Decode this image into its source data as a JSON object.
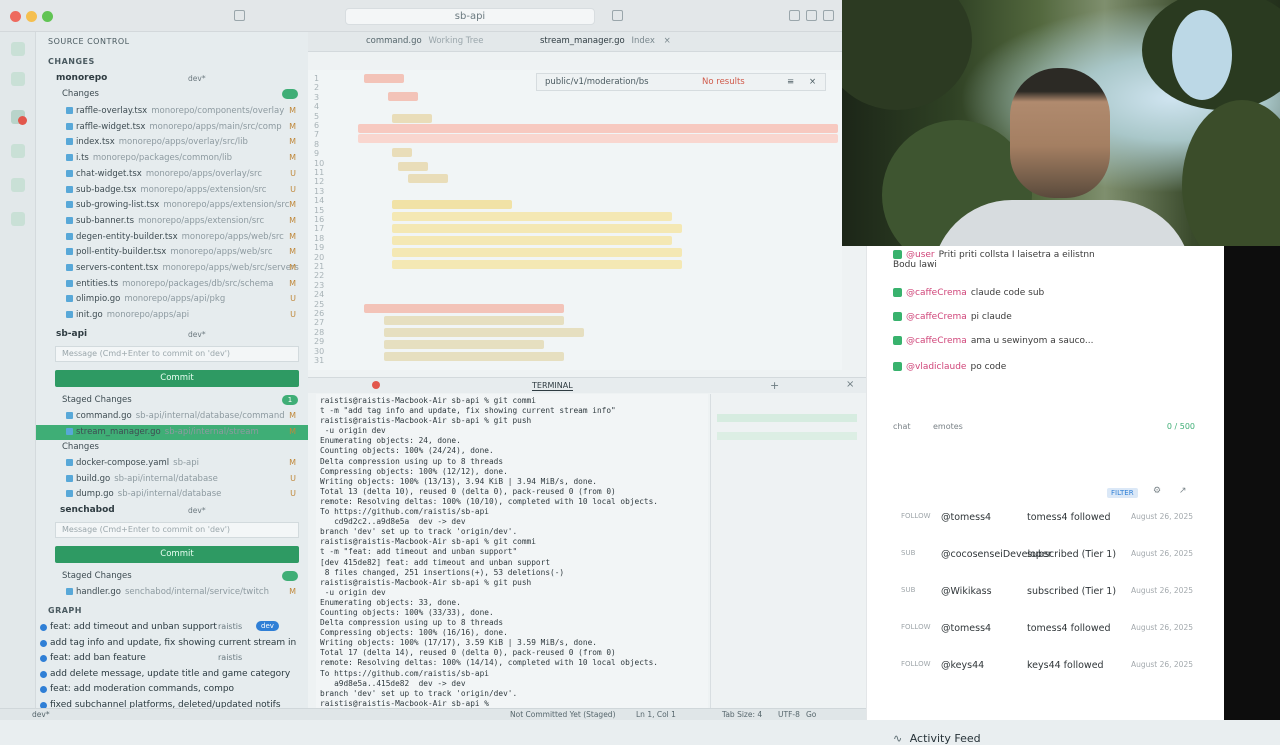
{
  "window": {
    "title": "sb-api",
    "search_placeholder": "sb-api"
  },
  "scm": {
    "header": "SOURCE CONTROL",
    "changes_heading": "CHANGES",
    "graph_heading": "GRAPH",
    "repos": [
      {
        "name": "monorepo",
        "branch": "dev*"
      },
      {
        "name": "sb-api",
        "branch": "dev*"
      },
      {
        "name": "senchabod",
        "branch": "dev*"
      }
    ],
    "monorepo_changes_label": "Changes",
    "monorepo_files": [
      {
        "name": "raffle-overlay.tsx",
        "path": "monorepo/components/overlay",
        "stat": "M"
      },
      {
        "name": "raffle-widget.tsx",
        "path": "monorepo/apps/main/src/comp",
        "stat": "M"
      },
      {
        "name": "index.tsx",
        "path": "monorepo/apps/overlay/src/lib",
        "stat": "M"
      },
      {
        "name": "i.ts",
        "path": "monorepo/packages/common/lib",
        "stat": "M"
      },
      {
        "name": "chat-widget.tsx",
        "path": "monorepo/apps/overlay/src",
        "stat": "U"
      },
      {
        "name": "sub-badge.tsx",
        "path": "monorepo/apps/extension/src",
        "stat": "U"
      },
      {
        "name": "sub-growing-list.tsx",
        "path": "monorepo/apps/extension/src",
        "stat": "M"
      },
      {
        "name": "sub-banner.ts",
        "path": "monorepo/apps/extension/src",
        "stat": "M"
      },
      {
        "name": "degen-entity-builder.tsx",
        "path": "monorepo/apps/web/src",
        "stat": "M"
      },
      {
        "name": "poll-entity-builder.tsx",
        "path": "monorepo/apps/web/src",
        "stat": "M"
      },
      {
        "name": "servers-content.tsx",
        "path": "monorepo/apps/web/src/servers",
        "stat": "M"
      },
      {
        "name": "entities.ts",
        "path": "monorepo/packages/db/src/schema",
        "stat": "M"
      },
      {
        "name": "olimpio.go",
        "path": "monorepo/apps/api/pkg",
        "stat": "U"
      },
      {
        "name": "init.go",
        "path": "monorepo/apps/api",
        "stat": "U"
      }
    ],
    "sbapi_input_placeholder": "Message (Cmd+Enter to commit on 'dev')",
    "commit_button": "Commit",
    "staged_label": "Staged Changes",
    "staged_count": "1",
    "sbapi_staged_files": [
      {
        "name": "command.go",
        "path": "sb-api/internal/database/command",
        "stat": "M"
      },
      {
        "name": "stream_manager.go",
        "path": "sb-api/internal/stream",
        "stat": "M"
      }
    ],
    "sbapi_changes_label": "Changes",
    "sbapi_files": [
      {
        "name": "docker-compose.yaml",
        "path": "sb-api",
        "stat": "M"
      },
      {
        "name": "build.go",
        "path": "sb-api/internal/database",
        "stat": "U"
      },
      {
        "name": "dump.go",
        "path": "sb-api/internal/database",
        "stat": "U"
      }
    ],
    "senchabod_input_placeholder": "Message (Cmd+Enter to commit on 'dev')",
    "senchabod_commit_button": "Commit",
    "senchabod_staged_label": "Staged Changes",
    "senchabod_staged_files": [
      {
        "name": "handler.go",
        "path": "senchabod/internal/service/twitch",
        "stat": "M"
      }
    ],
    "graph_commits": [
      {
        "text": "feat: add timeout and unban support",
        "author": "raistis",
        "tag": "dev"
      },
      {
        "text": "add tag info and update, fix showing current stream in",
        "author": "",
        "tag": ""
      },
      {
        "text": "feat: add ban feature",
        "author": "raistis",
        "tag": ""
      },
      {
        "text": "add delete message, update title and game category",
        "author": "",
        "tag": ""
      },
      {
        "text": "feat: add moderation commands, compo",
        "author": "",
        "tag": ""
      },
      {
        "text": "fixed subchannel platforms, deleted/updated notifs",
        "author": "",
        "tag": ""
      }
    ]
  },
  "editor": {
    "tabs": [
      {
        "label": "command.go",
        "note": "Working Tree",
        "active": false
      },
      {
        "label": "stream_manager.go",
        "note": "Index",
        "active": true
      }
    ],
    "find_query": "public/v1/moderation/bs",
    "find_result": "No results",
    "line_numbers": [
      "1",
      "2",
      "3",
      "4",
      "5",
      "6",
      "7",
      "8",
      "9",
      "10",
      "11",
      "12",
      "13",
      "14",
      "15",
      "16",
      "17",
      "18",
      "19",
      "20",
      "21",
      "22",
      "23",
      "24",
      "25",
      "26",
      "27",
      "28",
      "29",
      "30",
      "31"
    ]
  },
  "terminal": {
    "tab_label": "TERMINAL",
    "lines": [
      "raistis@raistis-Macbook-Air sb-api % git commi",
      "t -m \"add tag info and update, fix showing current stream info\"",
      "raistis@raistis-Macbook-Air sb-api % git push",
      " -u origin dev",
      "Enumerating objects: 24, done.",
      "Counting objects: 100% (24/24), done.",
      "Delta compression using up to 8 threads",
      "Compressing objects: 100% (12/12), done.",
      "Writing objects: 100% (13/13), 3.94 KiB | 3.94 MiB/s, done.",
      "Total 13 (delta 10), reused 0 (delta 0), pack-reused 0 (from 0)",
      "remote: Resolving deltas: 100% (10/10), completed with 10 local objects.",
      "To https://github.com/raistis/sb-api",
      "   cd9d2c2..a9d8e5a  dev -> dev",
      "branch 'dev' set up to track 'origin/dev'.",
      "raistis@raistis-Macbook-Air sb-api % git commi",
      "t -m \"feat: add timeout and unban support\"",
      "[dev 415de82] feat: add timeout and unban support",
      " 8 files changed, 251 insertions(+), 53 deletions(-)",
      "raistis@raistis-Macbook-Air sb-api % git push",
      " -u origin dev",
      "Enumerating objects: 33, done.",
      "Counting objects: 100% (33/33), done.",
      "Delta compression using up to 8 threads",
      "Compressing objects: 100% (16/16), done.",
      "Writing objects: 100% (17/17), 3.59 KiB | 3.59 MiB/s, done.",
      "Total 17 (delta 14), reused 0 (delta 0), pack-reused 0 (from 0)",
      "remote: Resolving deltas: 100% (14/14), completed with 10 local objects.",
      "To https://github.com/raistis/sb-api",
      "   a9d8e5a..415de82  dev -> dev",
      "branch 'dev' set up to track 'origin/dev'.",
      "raistis@raistis-Macbook-Air sb-api % "
    ]
  },
  "statusbar": {
    "branch": "dev*",
    "commit_state": "Not Committed Yet (Staged)",
    "cursor": "Ln 1, Col 1",
    "tab_size": "Tab Size: 4",
    "encoding": "UTF-8",
    "language": "Go"
  },
  "chat": {
    "messages": [
      {
        "user": "@user",
        "text": "Priti priti collsta I laisetra a eilistnn",
        "continuation": "Bodu lawi"
      },
      {
        "user": "@caffeCrema",
        "text": "claude code sub"
      },
      {
        "user": "@caffeCrema",
        "text": "pi claude"
      },
      {
        "user": "@caffeCrema",
        "text": "ama u sewinyom a sauco..."
      },
      {
        "user": "@vladiclaude",
        "text": "po code"
      }
    ],
    "input_placeholder": "chat",
    "input_hint": "emotes",
    "input_count": "0 / 500"
  },
  "activity_feed": {
    "title": "Activity Feed",
    "filter_label": "FILTER",
    "events": [
      {
        "type": "FOLLOW",
        "user": "@tomess4",
        "action": "tomess4 followed",
        "time": "August 26, 2025"
      },
      {
        "type": "SUB",
        "user": "@cocosenseiDeveloper",
        "action": "subscribed (Tier 1)",
        "time": "August 26, 2025"
      },
      {
        "type": "SUB",
        "user": "@Wikikass",
        "action": "subscribed (Tier 1)",
        "time": "August 26, 2025"
      },
      {
        "type": "FOLLOW",
        "user": "@tomess4",
        "action": "tomess4 followed",
        "time": "August 26, 2025"
      },
      {
        "type": "FOLLOW",
        "user": "@keys44",
        "action": "keys44 followed",
        "time": "August 26, 2025"
      }
    ]
  },
  "colors": {
    "accent_green": "#2e9a63",
    "graph_blue": "#2f7fd6",
    "chat_user_pink": "#d0467a",
    "activity_bar": "#e2e8ea"
  }
}
